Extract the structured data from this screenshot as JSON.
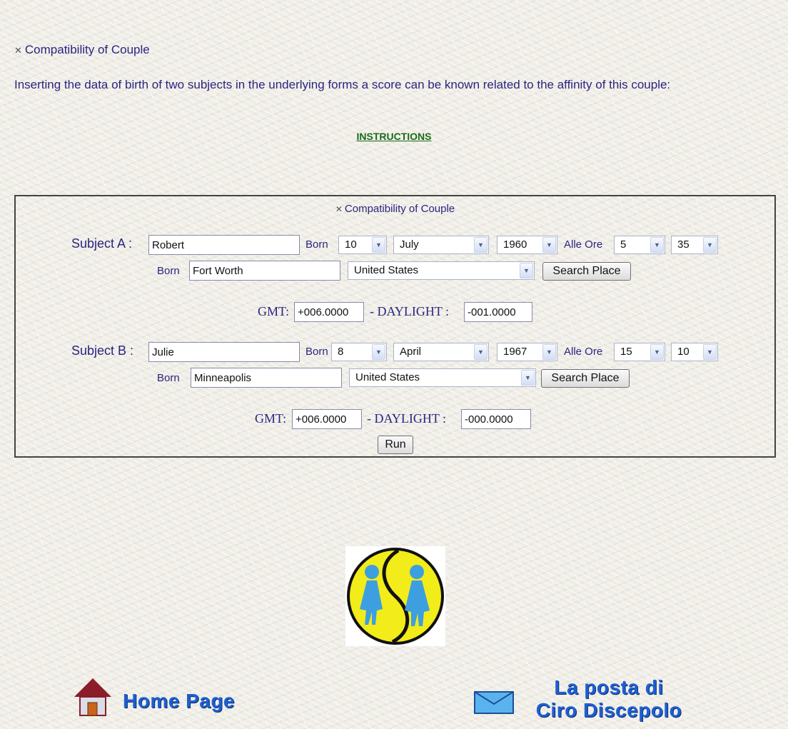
{
  "page": {
    "heading": "Compatibility of Couple",
    "intro": "Inserting the data of birth of two subjects in the underlying forms a score can be known related to the affinity of this couple:",
    "instructions_link": "INSTRUCTIONS"
  },
  "form": {
    "title": "Compatibility of Couple",
    "born_label": "Born",
    "alle_ore_label": "Alle Ore",
    "gmt_label": "GMT:",
    "daylight_label": "- DAYLIGHT :",
    "search_button": "Search Place",
    "run_button": "Run",
    "subject_a": {
      "label": "Subject A :",
      "name": "Robert",
      "day": "10",
      "month": "July",
      "year": "1960",
      "hour": "5",
      "minute": "35",
      "place": "Fort Worth",
      "country": "United States",
      "gmt": "+006.0000",
      "daylight": "-001.0000"
    },
    "subject_b": {
      "label": "Subject B :",
      "name": "Julie",
      "day": "8",
      "month": "April",
      "year": "1967",
      "hour": "15",
      "minute": "10",
      "place": "Minneapolis",
      "country": "United States",
      "gmt": "+006.0000",
      "daylight": "-000.0000"
    }
  },
  "footer": {
    "home_link": "Home Page",
    "mail_link_line1": "La posta di",
    "mail_link_line2": "Ciro Discepolo"
  },
  "icons": {
    "heading_bullet": "x-bullet-icon",
    "home": "house-icon",
    "mail": "envelope-icon",
    "logo": "yin-yang-couple-logo",
    "dropdown": "chevron-down-icon"
  },
  "colors": {
    "text": "#2b2580",
    "link_green": "#1a6b1a",
    "footer_link": "#1e5fd0",
    "logo_yellow": "#f2ec1a",
    "logo_figures": "#3d9fe0",
    "house_roof": "#8b1c2a"
  }
}
